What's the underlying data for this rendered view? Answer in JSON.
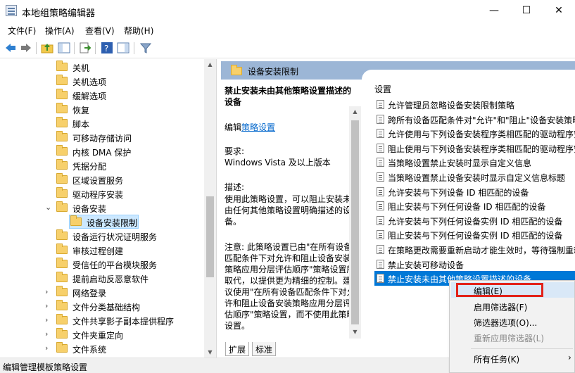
{
  "window": {
    "title": "本地组策略编辑器",
    "minimize_glyph": "—",
    "maximize_glyph": "☐",
    "close_glyph": "✕"
  },
  "menubar": [
    "文件(F)",
    "操作(A)",
    "查看(V)",
    "帮助(H)"
  ],
  "toolbar": {
    "icons": [
      "back-icon",
      "forward-icon",
      "up-folder-icon",
      "show-hide-tree-icon",
      "export-list-icon",
      "help-icon",
      "show-hide-pane-icon",
      "filter-icon"
    ]
  },
  "tree": {
    "items": [
      {
        "label": "关机"
      },
      {
        "label": "关机选项"
      },
      {
        "label": "缓解选项"
      },
      {
        "label": "恢复"
      },
      {
        "label": "脚本"
      },
      {
        "label": "可移动存储访问"
      },
      {
        "label": "内核 DMA 保护"
      },
      {
        "label": "凭据分配"
      },
      {
        "label": "区域设置服务"
      },
      {
        "label": "驱动程序安装"
      },
      {
        "label": "设备安装"
      },
      {
        "label": "设备安装限制"
      },
      {
        "label": "设备运行状况证明服务"
      },
      {
        "label": "审核过程创建"
      },
      {
        "label": "受信任的平台模块服务"
      },
      {
        "label": "提前启动反恶意软件"
      },
      {
        "label": "网络登录"
      },
      {
        "label": "文件分类基础结构"
      },
      {
        "label": "文件共享影子副本提供程序"
      },
      {
        "label": "文件夹重定向"
      },
      {
        "label": "文件系统"
      }
    ]
  },
  "header": {
    "title": "设备安装限制"
  },
  "description": {
    "title": "禁止安装未由其他策略设置描述的设备",
    "edit_prefix": "编辑",
    "edit_link": "策略设置",
    "req_label": "要求:",
    "req_value": "Windows Vista 及以上版本",
    "desc_label": "描述:",
    "desc_text": "使用此策略设置，可以阻止安装未由任何其他策略设置明确描述的设备。",
    "note_text": "注意: 此策略设置已由\"在所有设备匹配条件下对允许和阻止设备安装策略应用分层评估顺序\"策略设置所取代，以提供更为精细的控制。建议使用\"在所有设备匹配条件下对允许和阻止设备安装策略应用分层评估顺序\"策略设置，而不使用此策略设置。"
  },
  "settings": {
    "column_header": "设置",
    "items": [
      {
        "label": "允许管理员忽略设备安装限制策略"
      },
      {
        "label": "跨所有设备匹配条件对\"允许\"和\"阻止\"设备安装策略"
      },
      {
        "label": "允许使用与下列设备安装程序类相匹配的驱动程序安"
      },
      {
        "label": "阻止使用与下列设备安装程序类相匹配的驱动程序安"
      },
      {
        "label": "当策略设置禁止安装时显示自定义信息"
      },
      {
        "label": "当策略设置禁止设备安装时显示自定义信息标题"
      },
      {
        "label": "允许安装与下列设备 ID 相匹配的设备"
      },
      {
        "label": "阻止安装与下列任何设备 ID 相匹配的设备"
      },
      {
        "label": "允许安装与下列任何设备实例 ID 相匹配的设备"
      },
      {
        "label": "阻止安装与下列任何设备实例 ID 相匹配的设备"
      },
      {
        "label": "在策略更改需要重新启动才能生效时，等待强制重新"
      },
      {
        "label": "禁止安装可移动设备"
      },
      {
        "label": "禁止安装未由其他策略设置描述的设备"
      }
    ]
  },
  "tabs": [
    "扩展",
    "标准"
  ],
  "status": "编辑管理模板策略设置",
  "context_menu": {
    "items": [
      {
        "label": "编辑(E)",
        "enabled": true
      },
      {
        "label": "启用筛选器(F)",
        "enabled": true
      },
      {
        "label": "筛选器选项(O)...",
        "enabled": true
      },
      {
        "label": "重新应用筛选器(L)",
        "enabled": false
      },
      {
        "label": "所有任务(K)",
        "enabled": true,
        "submenu_glyph": "›"
      }
    ]
  }
}
